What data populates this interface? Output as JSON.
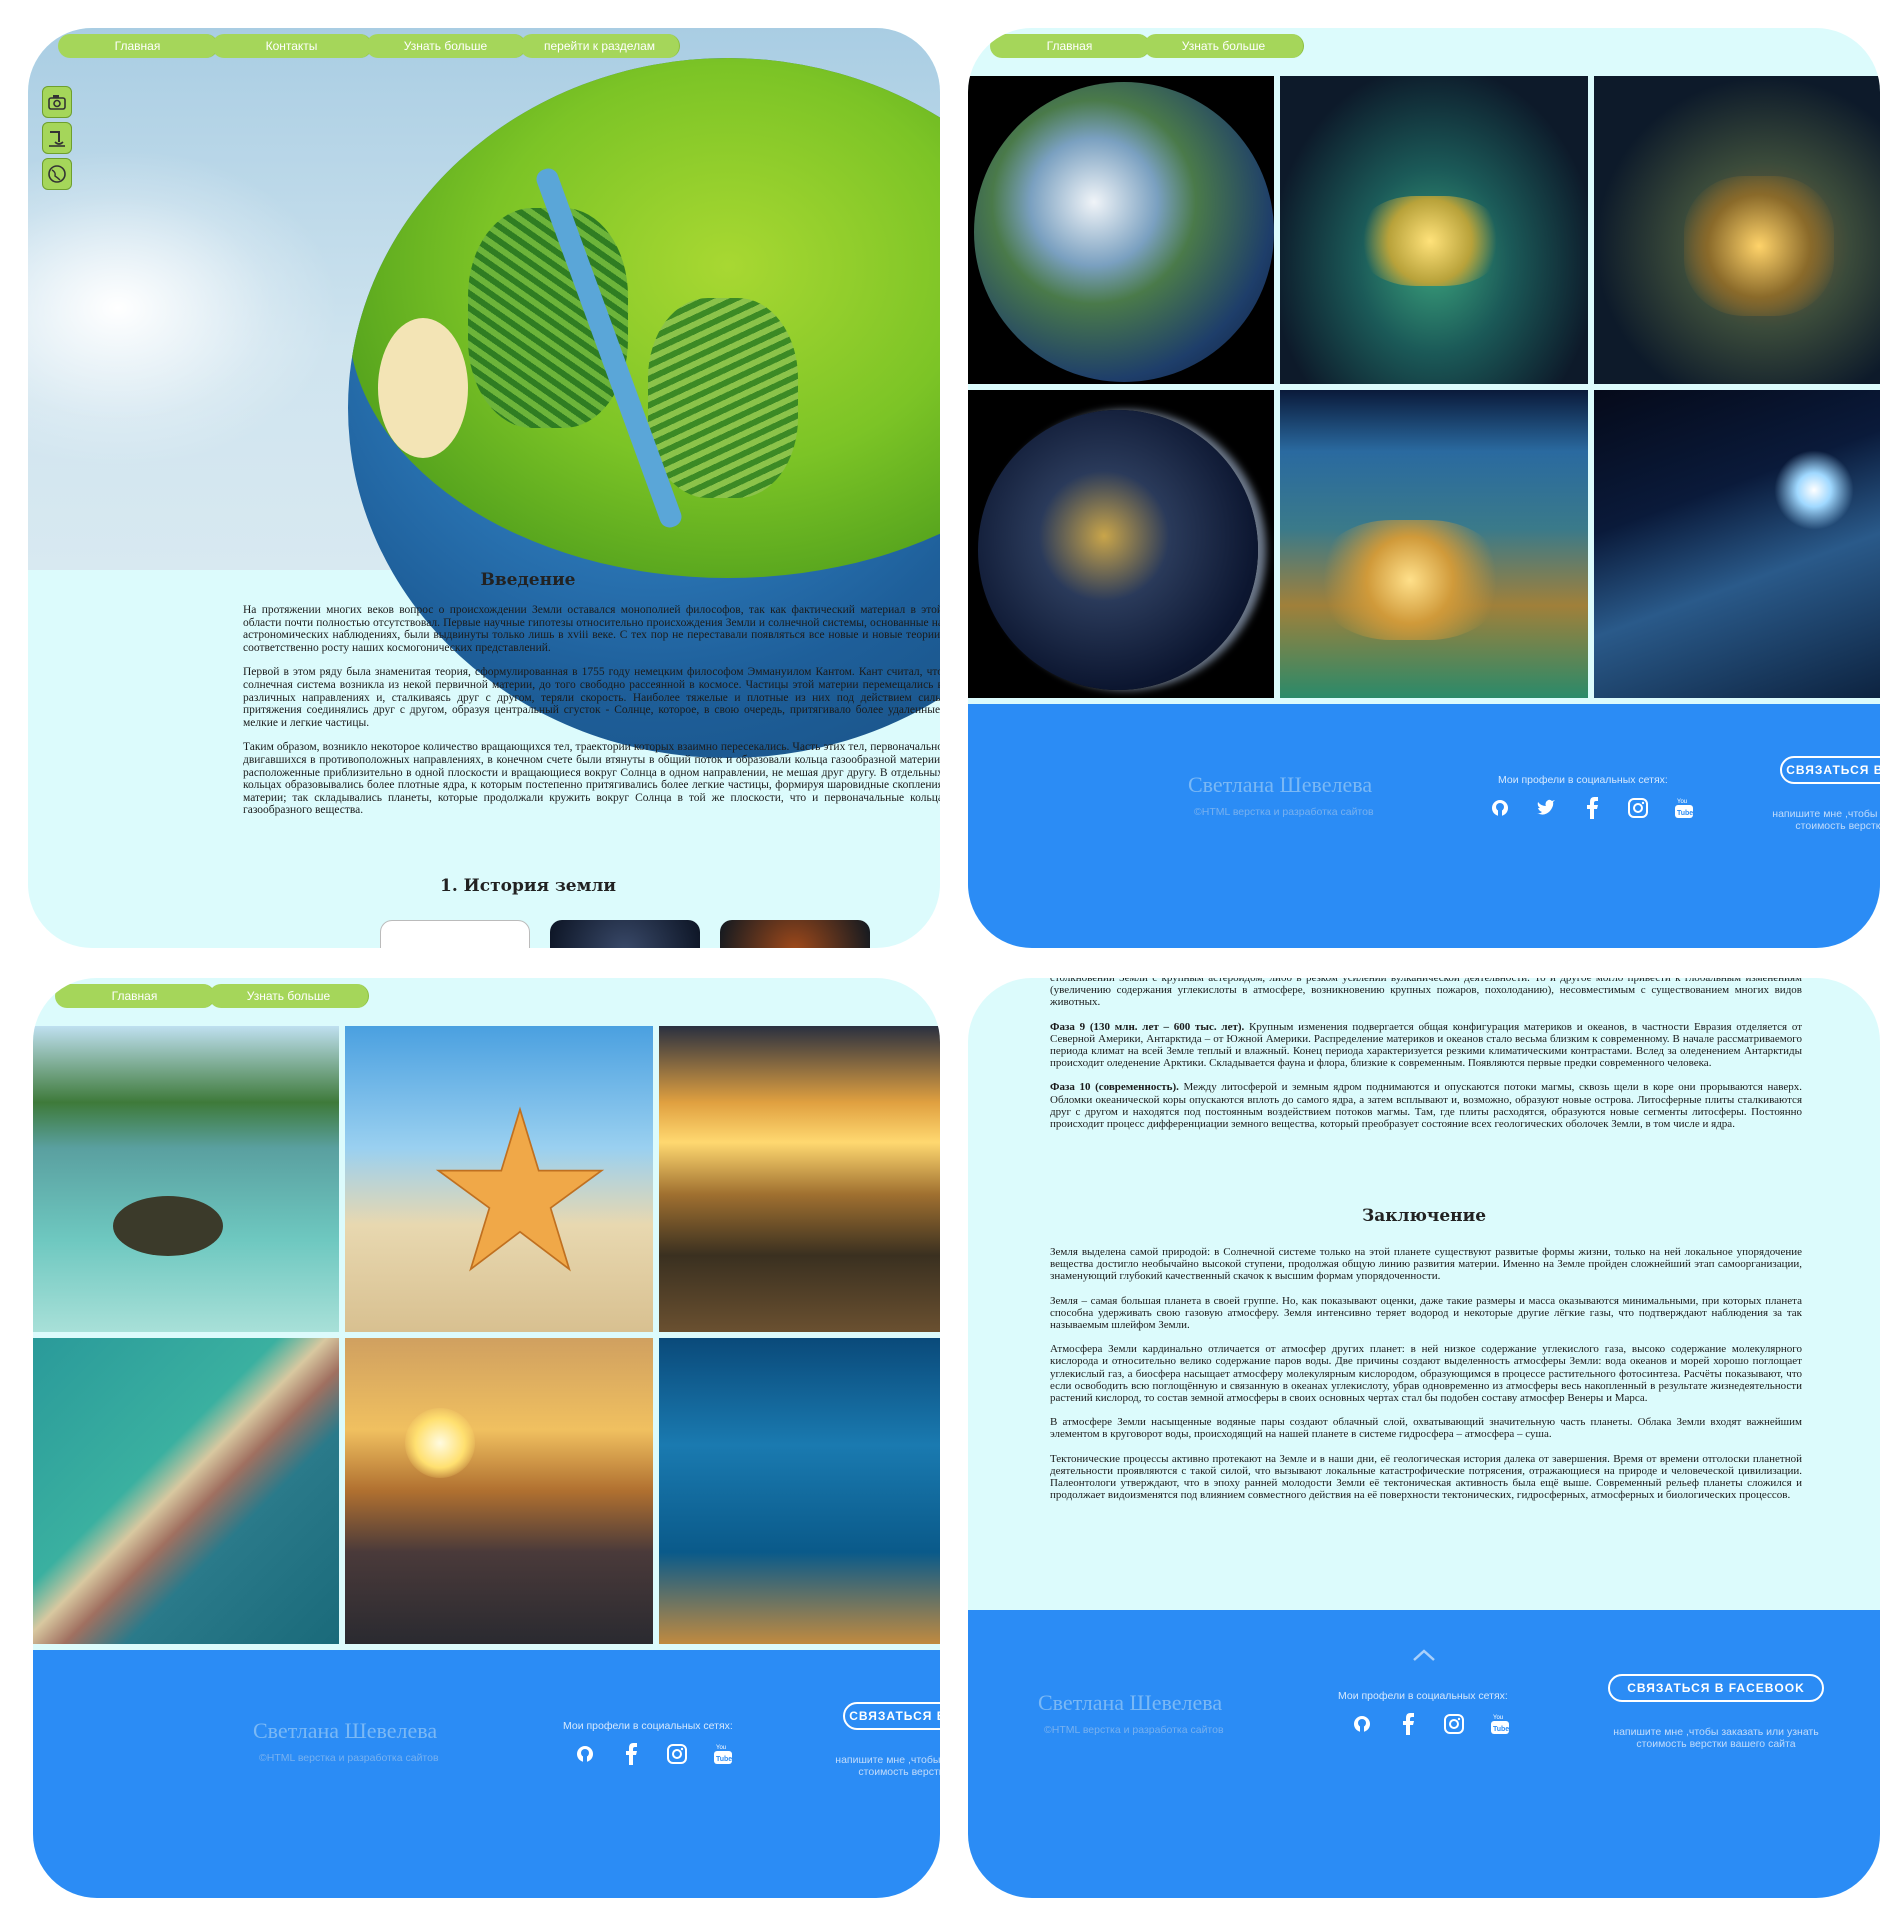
{
  "nav_main": [
    "Главная",
    "Контакты",
    "Узнать больше",
    "перейти к разделам"
  ],
  "nav_short": [
    "Главная",
    "Узнать больше"
  ],
  "side_icons": [
    "camera-icon",
    "waterfall-icon",
    "globe-icon"
  ],
  "intro": {
    "title": "Введение",
    "paragraphs": [
      "На протяжении многих веков вопрос о происхождении Земли оставался монополией философов, так как фактический материал в этой области почти полностью отсутствовал. Первые научные гипотезы относительно происхождения Земли и солнечной системы, основанные на астрономических наблюдениях, были выдвинуты только лишь в xviii веке. С тех пор не переставали появляться все новые и новые теории, соответственно росту наших космогонических представлений.",
      "Первой в этом ряду была знаменитая теория, сформулированная в 1755 году немецким философом Эммануилом Кантом. Кант считал, что солнечная система возникла из некой первичной материи, до того свободно рассеянной в космосе. Частицы этой материи перемещались в различных направлениях и, сталкиваясь друг с другом, теряли скорость. Наиболее тяжелые и плотные из них под действием силы притяжения соединялись друг с другом, образуя центральный сгусток - Солнце, которое, в свою очередь, притягивало более удаленные, мелкие и легкие частицы.",
      "Таким образом, возникло некоторое количество вращающихся тел, траектории которых взаимно пересекались. Часть этих тел, первоначально двигавшихся в противоположных направлениях, в конечном счете были втянуты в общий поток и образовали кольца газообразной материи, расположенные приблизительно в одной плоскости и вращающиеся вокруг Солнца в одном направлении, не мешая друг другу. В отдельных кольцах образовывались более плотные ядра, к которым постепенно притягивались более легкие частицы, формируя шаровидные скопления материи; так складывались планеты, которые продолжали кружить вокруг Солнца в той же плоскости, что и первоначальные кольца газообразного вещества."
    ],
    "section_title": "1. История земли"
  },
  "footer": {
    "name": "Светлана Шевелева",
    "subtitle": "©HTML верстка и разработка сайтов",
    "social_label": "Мои профели в социальных сетях:",
    "button": "СВЯЗАТЬСЯ В FACEBOOK",
    "note": "напишите мне ,чтобы заказать или узнать стоимость верстки вашего сайта",
    "icons_a": [
      "github-icon",
      "twitter-icon",
      "facebook-icon",
      "instagram-icon",
      "youtube-icon"
    ],
    "icons_b": [
      "github-icon",
      "facebook-icon",
      "instagram-icon",
      "youtube-icon"
    ]
  },
  "phases": {
    "top_cut": "столкновении Земли с крупным астероидом, либо в резком усилении вулканической деятельности. То и другое могло привести к глобальным изменениям (увеличению содержания углекислоты в атмосфере, возникновению крупных пожаров, похолоданию), несовместимым с существованием многих видов животных.",
    "p9_label": "Фаза 9 (130 млн. лет – 600 тыс. лет).",
    "p9": " Крупным изменения подвергается общая конфигурация материков и океанов, в частности Евразия отделяется от Северной Америки, Антарктида – от Южной Америки. Распределение материков и океанов стало весьма близким к современному. В начале рассматриваемого периода климат на всей Земле теплый и влажный. Конец периода характеризуется резкими климатическими контрастами. Вслед за оледенением Антарктиды происходит оледенение Арктики. Складывается фауна и флора, близкие к современным. Появляются первые предки современного человека.",
    "p10_label": "Фаза 10 (современность).",
    "p10": " Между литосферой и земным ядром поднимаются и опускаются потоки магмы, сквозь щели в коре они прорываются наверх. Обломки океанической коры опускаются вплоть до самого ядра, а затем всплывают и, возможно, образуют новые острова. Литосферные плиты сталкиваются друг с другом и находятся под постоянным воздействием потоков магмы. Там, где плиты расходятся, образуются новые сегменты литосферы. Постоянно происходит процесс дифференциации земного вещества, который преобразует состояние всех геологических оболочек Земли, в том числе и ядра."
  },
  "conclusion": {
    "title": "Заключение",
    "paragraphs": [
      "Земля выделена самой природой: в Солнечной системе только на этой планете существуют развитые формы жизни, только на ней локальное упорядочение вещества достигло необычайно высокой ступени, продолжая общую линию развития материи. Именно на Земле пройден сложнейший этап самоорганизации, знаменующий глубокий качественный скачок к высшим формам упорядоченности.",
      "Земля – самая большая планета в своей группе. Но, как показывают оценки, даже такие размеры и масса оказываются минимальными, при которых планета способна удерживать свою газовую атмосферу. Земля интенсивно теряет водород и некоторые другие лёгкие газы, что подтверждают наблюдения за так называемым шлейфом Земли.",
      "Атмосфера Земли кардинально отличается от атмосфер других планет: в ней низкое содержание углекислого газа, высоко содержание молекулярного кислорода и относительно велико содержание паров воды. Две причины создают выделенность атмосферы Земли: вода океанов и морей хорошо поглощает углекислый газ, а биосфера насыщает атмосферу молекулярным кислородом, образующимся в процессе растительного фотосинтеза. Расчёты показывают, что если освободить всю поглощённую и связанную в океанах углекислоту, убрав одновременно из атмосферы весь накопленный в результате жизнедеятельности растений кислород, то состав земной атмосферы в своих основных чертах стал бы подобен составу атмосфер Венеры и Марса.",
      "В атмосфере Земли насыщенные водяные пары создают облачный слой, охватывающий значительную часть планеты. Облака Земли входят важнейшим элементом в круговорот воды, происходящий на нашей планете в системе гидросфера – атмосфера – суша.",
      "Тектонические процессы активно протекают на Земле и в наши дни, её геологическая история далека от завершения. Время от времени отголоски планетной деятельности проявляются с такой силой, что вызывают локальные катастрофические потрясения, отражающиеся на природе и человеческой цивилизации. Палеонтологи утверждают, что в эпоху ранней молодости Земли её тектоническая активность была ещё выше. Современный рельеф планеты сложился и продолжает видоизменятся под влиянием совместного действия на её поверхности тектонических, гидросферных, атмосферных и биологических процессов."
    ]
  }
}
